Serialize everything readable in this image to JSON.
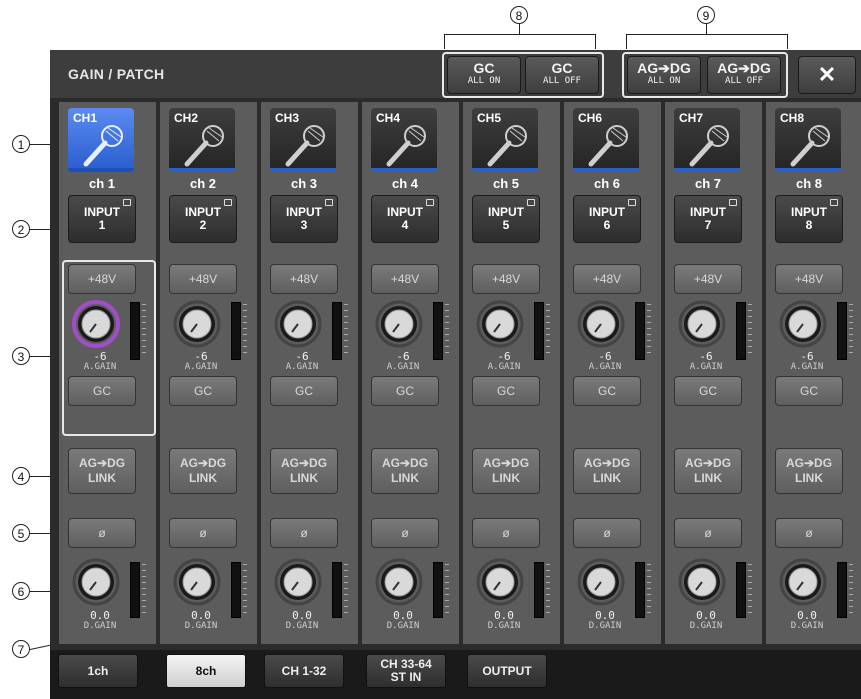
{
  "window": {
    "title": "GAIN / PATCH",
    "close_icon": "✕"
  },
  "header_buttons": [
    {
      "main": "GC",
      "sub": "ALL ON"
    },
    {
      "main": "GC",
      "sub": "ALL OFF"
    },
    {
      "main": "AG➔DG",
      "sub": "ALL ON"
    },
    {
      "main": "AG➔DG",
      "sub": "ALL OFF"
    }
  ],
  "callouts": [
    "1",
    "2",
    "3",
    "4",
    "5",
    "6",
    "7",
    "8",
    "9"
  ],
  "channels": [
    {
      "label": "CH1",
      "name": "ch 1",
      "input_line1": "INPUT",
      "input_line2": "1",
      "phantom": "+48V",
      "again_value": "-6",
      "again_label": "A.GAIN",
      "gc": "GC",
      "link_line1": "AG➔DG",
      "link_line2": "LINK",
      "phase": "ø",
      "dgain_value": "0.0",
      "dgain_label": "D.GAIN",
      "selected": true
    },
    {
      "label": "CH2",
      "name": "ch 2",
      "input_line1": "INPUT",
      "input_line2": "2",
      "phantom": "+48V",
      "again_value": "-6",
      "again_label": "A.GAIN",
      "gc": "GC",
      "link_line1": "AG➔DG",
      "link_line2": "LINK",
      "phase": "ø",
      "dgain_value": "0.0",
      "dgain_label": "D.GAIN",
      "selected": false
    },
    {
      "label": "CH3",
      "name": "ch 3",
      "input_line1": "INPUT",
      "input_line2": "3",
      "phantom": "+48V",
      "again_value": "-6",
      "again_label": "A.GAIN",
      "gc": "GC",
      "link_line1": "AG➔DG",
      "link_line2": "LINK",
      "phase": "ø",
      "dgain_value": "0.0",
      "dgain_label": "D.GAIN",
      "selected": false
    },
    {
      "label": "CH4",
      "name": "ch 4",
      "input_line1": "INPUT",
      "input_line2": "4",
      "phantom": "+48V",
      "again_value": "-6",
      "again_label": "A.GAIN",
      "gc": "GC",
      "link_line1": "AG➔DG",
      "link_line2": "LINK",
      "phase": "ø",
      "dgain_value": "0.0",
      "dgain_label": "D.GAIN",
      "selected": false
    },
    {
      "label": "CH5",
      "name": "ch 5",
      "input_line1": "INPUT",
      "input_line2": "5",
      "phantom": "+48V",
      "again_value": "-6",
      "again_label": "A.GAIN",
      "gc": "GC",
      "link_line1": "AG➔DG",
      "link_line2": "LINK",
      "phase": "ø",
      "dgain_value": "0.0",
      "dgain_label": "D.GAIN",
      "selected": false
    },
    {
      "label": "CH6",
      "name": "ch 6",
      "input_line1": "INPUT",
      "input_line2": "6",
      "phantom": "+48V",
      "again_value": "-6",
      "again_label": "A.GAIN",
      "gc": "GC",
      "link_line1": "AG➔DG",
      "link_line2": "LINK",
      "phase": "ø",
      "dgain_value": "0.0",
      "dgain_label": "D.GAIN",
      "selected": false
    },
    {
      "label": "CH7",
      "name": "ch 7",
      "input_line1": "INPUT",
      "input_line2": "7",
      "phantom": "+48V",
      "again_value": "-6",
      "again_label": "A.GAIN",
      "gc": "GC",
      "link_line1": "AG➔DG",
      "link_line2": "LINK",
      "phase": "ø",
      "dgain_value": "0.0",
      "dgain_label": "D.GAIN",
      "selected": false
    },
    {
      "label": "CH8",
      "name": "ch 8",
      "input_line1": "INPUT",
      "input_line2": "8",
      "phantom": "+48V",
      "again_value": "-6",
      "again_label": "A.GAIN",
      "gc": "GC",
      "link_line1": "AG➔DG",
      "link_line2": "LINK",
      "phase": "ø",
      "dgain_value": "0.0",
      "dgain_label": "D.GAIN",
      "selected": false
    }
  ],
  "tabs": [
    {
      "line1": "1ch",
      "line2": "",
      "active": false
    },
    {
      "line1": "8ch",
      "line2": "",
      "active": true
    },
    {
      "line1": "CH 1-32",
      "line2": "",
      "active": false
    },
    {
      "line1": "CH 33-64",
      "line2": "ST IN",
      "active": false
    },
    {
      "line1": "OUTPUT",
      "line2": "",
      "active": false
    }
  ],
  "colors": {
    "accent_blue": "#2a5fc4",
    "selected_blue": "#4a7de8",
    "gain_ring_purple": "#a24dc9"
  }
}
